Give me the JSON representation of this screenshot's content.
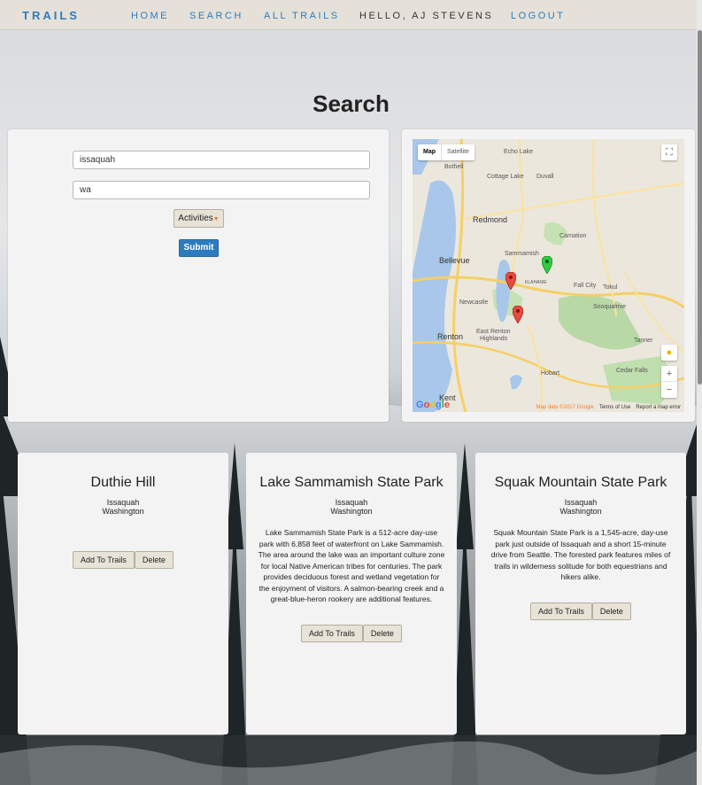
{
  "navbar": {
    "brand": "TRAILS",
    "home": "HOME",
    "search": "SEARCH",
    "all_trails": "ALL TRAILS",
    "greeting": "HELLO, AJ STEVENS",
    "logout": "LOGOUT"
  },
  "page": {
    "title": "Search"
  },
  "search_form": {
    "city_value": "issaquah",
    "state_value": "wa",
    "activities_label": "Activities",
    "submit_label": "Submit"
  },
  "map": {
    "map_label": "Map",
    "satellite_label": "Satellite",
    "labels": {
      "echo_lake": "Echo Lake",
      "bothell": "Bothell",
      "cottage_lake": "Cottage Lake",
      "duvall": "Duvall",
      "redmond": "Redmond",
      "carnation": "Carnation",
      "sammamish": "Sammamish",
      "bellevue": "Bellevue",
      "klahanie": "KLAHANIE",
      "fall_city": "Fall City",
      "tokul": "Tokul",
      "newcastle": "Newcastle",
      "snoqualmie": "Snoqualmie",
      "east_renton": "East Renton",
      "highlands": "Highlands",
      "renton": "Renton",
      "tanner": "Tanner",
      "hobart": "Hobart",
      "cedar_falls": "Cedar Falls",
      "kent": "Kent"
    },
    "footer_data": "Map data ©2017 Google",
    "footer_terms": "Terms of Use",
    "footer_report": "Report a map error",
    "google": [
      "G",
      "o",
      "o",
      "g",
      "l",
      "e"
    ],
    "zoom_in": "+",
    "zoom_out": "−",
    "markers": [
      {
        "color": "#e84a3d"
      },
      {
        "color": "#e84a3d"
      },
      {
        "color": "#2ecc40"
      }
    ]
  },
  "parks": [
    {
      "name": "Duthie Hill",
      "city": "Issaquah",
      "state": "Washington",
      "description": "",
      "add_label": "Add To Trails",
      "delete_label": "Delete"
    },
    {
      "name": "Lake Sammamish State Park",
      "city": "Issaquah",
      "state": "Washington",
      "description": "Lake Sammamish State Park is a 512-acre day-use park with 6,858 feet of waterfront on Lake Sammamish. The area around the lake was an important culture zone for local Native American tribes for centuries. The park provides deciduous forest and wetland vegetation for the enjoyment of visitors. A salmon-bearing creek and a great-blue-heron rookery are additional features.",
      "add_label": "Add To Trails",
      "delete_label": "Delete"
    },
    {
      "name": "Squak Mountain State Park",
      "city": "Issaquah",
      "state": "Washington",
      "description": "Squak Mountain State Park is a 1,545-acre, day-use park just outside of Issaquah and a short 15-minute drive from Seattle. The forested park features miles of trails in wilderness solitude for both equestrians and hikers alike.",
      "add_label": "Add To Trails",
      "delete_label": "Delete"
    }
  ]
}
